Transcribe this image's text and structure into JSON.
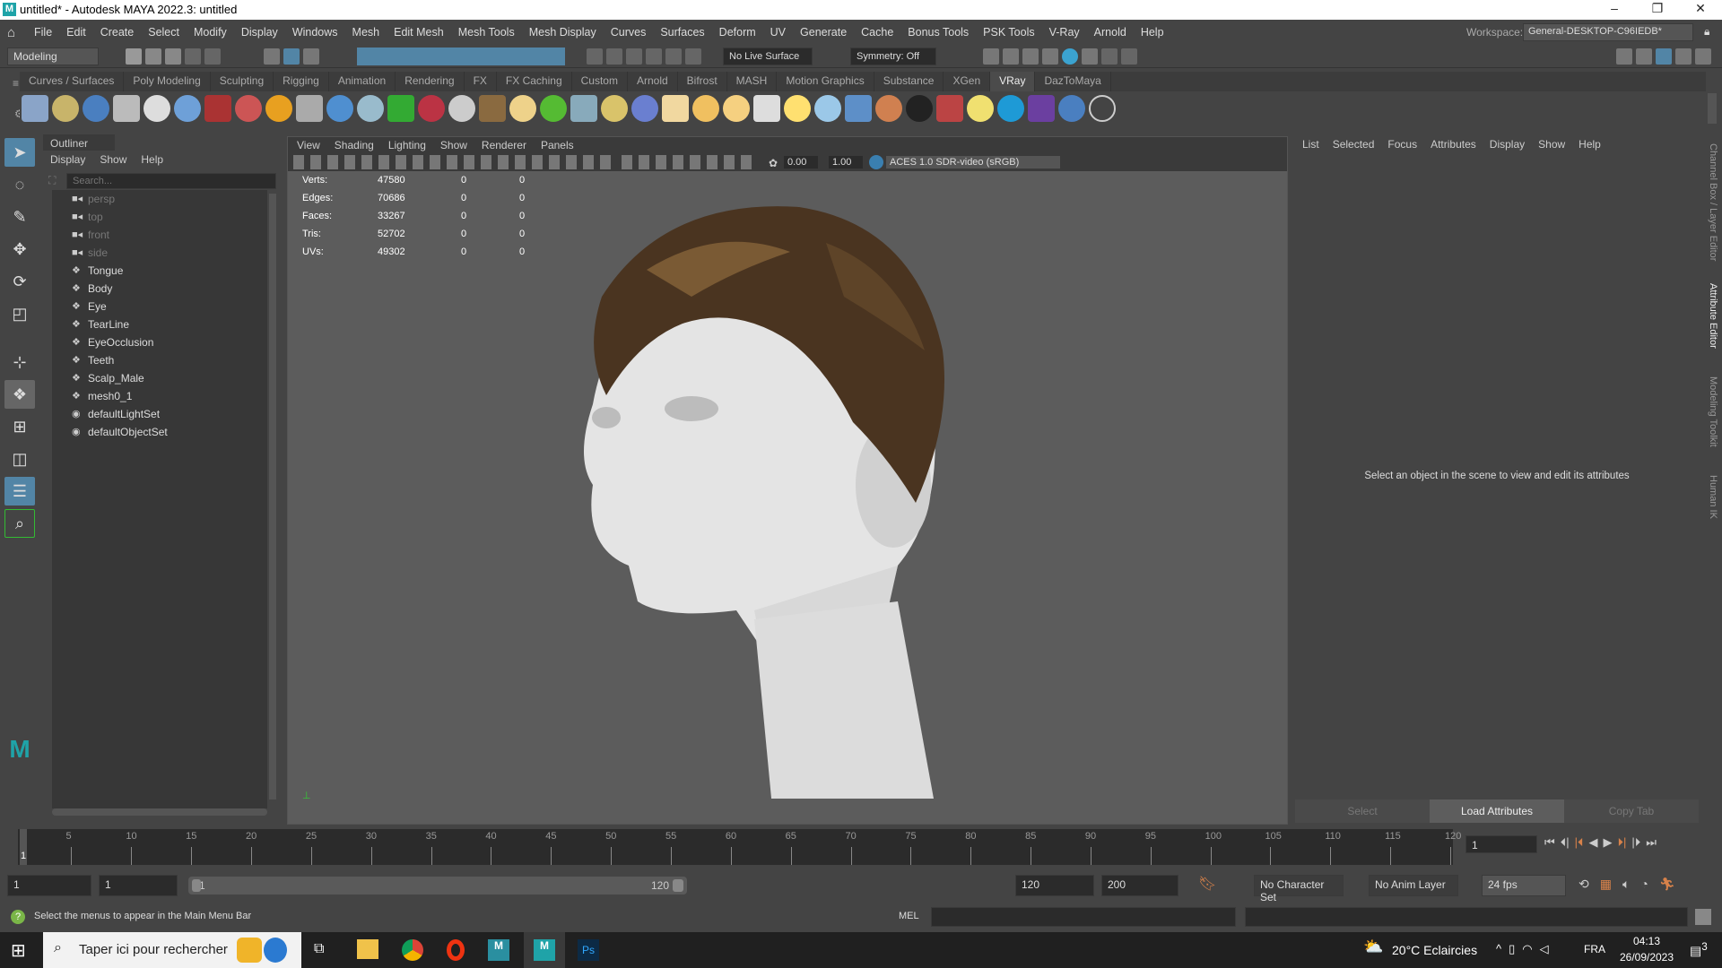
{
  "window": {
    "title": "untitled* - Autodesk MAYA 2022.3: untitled",
    "logo": "M",
    "minimize": "–",
    "maximize": "❐",
    "close": "✕"
  },
  "menubar": {
    "items": [
      "File",
      "Edit",
      "Create",
      "Select",
      "Modify",
      "Display",
      "Windows",
      "Mesh",
      "Edit Mesh",
      "Mesh Tools",
      "Mesh Display",
      "Curves",
      "Surfaces",
      "Deform",
      "UV",
      "Generate",
      "Cache",
      "Bonus Tools",
      "PSK Tools",
      "V-Ray",
      "Arnold",
      "Help"
    ],
    "workspace_label": "Workspace:",
    "workspace_value": "General-DESKTOP-C96IEDB*"
  },
  "statusline": {
    "mode": "Modeling",
    "live_surface": "No Live Surface",
    "symmetry": "Symmetry: Off"
  },
  "shelf": {
    "tabs": [
      "Curves / Surfaces",
      "Poly Modeling",
      "Sculpting",
      "Rigging",
      "Animation",
      "Rendering",
      "FX",
      "FX Caching",
      "Custom",
      "Arnold",
      "Bifrost",
      "MASH",
      "Motion Graphics",
      "Substance",
      "XGen",
      "VRay",
      "DazToMaya"
    ],
    "active": "VRay",
    "icons": [
      "save-scene-icon",
      "import-icon",
      "file-list-icon",
      "plugin-icon",
      "vray-settings-icon",
      "material-sphere-icon",
      "frame-buffer-icon",
      "two-spheres-icon",
      "fire-icon",
      "wireframe-icon",
      "cube-sphere-icon",
      "cone-icon",
      "light-plane-icon",
      "sphere-red-icon",
      "sphere-selected-icon",
      "texture-icon",
      "globe-icon",
      "grass-icon",
      "cluster-icon",
      "curve-icon",
      "blue-sphere-icon",
      "dome-light-icon",
      "spot-light-icon",
      "sun-sphere-icon",
      "cone-light-icon",
      "sun-icon",
      "plane-icon",
      "glossy-sphere-icon",
      "half-sphere-icon",
      "checker-icon",
      "render-window-icon",
      "bulb-icon",
      "vision-icon",
      "chaos-icon",
      "balls-icon",
      "help-icon"
    ],
    "colors": {
      "vision": "#1e9ad6",
      "chaos": "#6b3fa0"
    }
  },
  "outliner": {
    "title": "Outliner",
    "menus": [
      "Display",
      "Show",
      "Help"
    ],
    "search_placeholder": "Search...",
    "items": [
      {
        "name": "persp",
        "type": "camera"
      },
      {
        "name": "top",
        "type": "camera"
      },
      {
        "name": "front",
        "type": "camera"
      },
      {
        "name": "side",
        "type": "camera"
      },
      {
        "name": "Tongue",
        "type": "mesh"
      },
      {
        "name": "Body",
        "type": "mesh"
      },
      {
        "name": "Eye",
        "type": "mesh"
      },
      {
        "name": "TearLine",
        "type": "mesh"
      },
      {
        "name": "EyeOcclusion",
        "type": "mesh"
      },
      {
        "name": "Teeth",
        "type": "mesh"
      },
      {
        "name": "Scalp_Male",
        "type": "mesh"
      },
      {
        "name": "mesh0_1",
        "type": "mesh"
      },
      {
        "name": "defaultLightSet",
        "type": "set"
      },
      {
        "name": "defaultObjectSet",
        "type": "set"
      }
    ]
  },
  "viewport": {
    "menus": [
      "View",
      "Shading",
      "Lighting",
      "Show",
      "Renderer",
      "Panels"
    ],
    "exposure": "0.00",
    "gamma": "1.00",
    "color_space": "ACES 1.0 SDR-video (sRGB)",
    "hud": [
      {
        "label": "Verts:",
        "v": "47580",
        "a": "0",
        "b": "0"
      },
      {
        "label": "Edges:",
        "v": "70686",
        "a": "0",
        "b": "0"
      },
      {
        "label": "Faces:",
        "v": "33267",
        "a": "0",
        "b": "0"
      },
      {
        "label": "Tris:",
        "v": "52702",
        "a": "0",
        "b": "0"
      },
      {
        "label": "UVs:",
        "v": "49302",
        "a": "0",
        "b": "0"
      }
    ]
  },
  "attribute_editor": {
    "menus": [
      "List",
      "Selected",
      "Focus",
      "Attributes",
      "Display",
      "Show",
      "Help"
    ],
    "message": "Select an object in the scene to view and edit its attributes",
    "buttons": [
      "Select",
      "Load Attributes",
      "Copy Tab"
    ]
  },
  "side_tabs": [
    "Channel Box / Layer Editor",
    "Attribute Editor",
    "Modeling Toolkit",
    "Human IK"
  ],
  "timeline": {
    "ticks": [
      "5",
      "10",
      "15",
      "20",
      "25",
      "30",
      "35",
      "40",
      "45",
      "50",
      "55",
      "60",
      "65",
      "70",
      "75",
      "80",
      "85",
      "90",
      "95",
      "100",
      "105",
      "110",
      "115",
      "120"
    ],
    "current": "1",
    "current_frame_field": "1"
  },
  "range": {
    "start": "1",
    "anim_start": "1",
    "range_start": "1",
    "range_end": "120",
    "end": "120",
    "anim_end": "200",
    "character_set": "No Character Set",
    "anim_layer": "No Anim Layer",
    "fps": "24 fps"
  },
  "commandline": {
    "help": "Select the menus to appear in the Main Menu Bar",
    "lang": "MEL"
  },
  "taskbar": {
    "search": "Taper ici pour rechercher",
    "weather": "20°C  Eclaircies",
    "lang": "FRA",
    "time": "04:13",
    "date": "26/09/2023",
    "notifications": "3"
  }
}
